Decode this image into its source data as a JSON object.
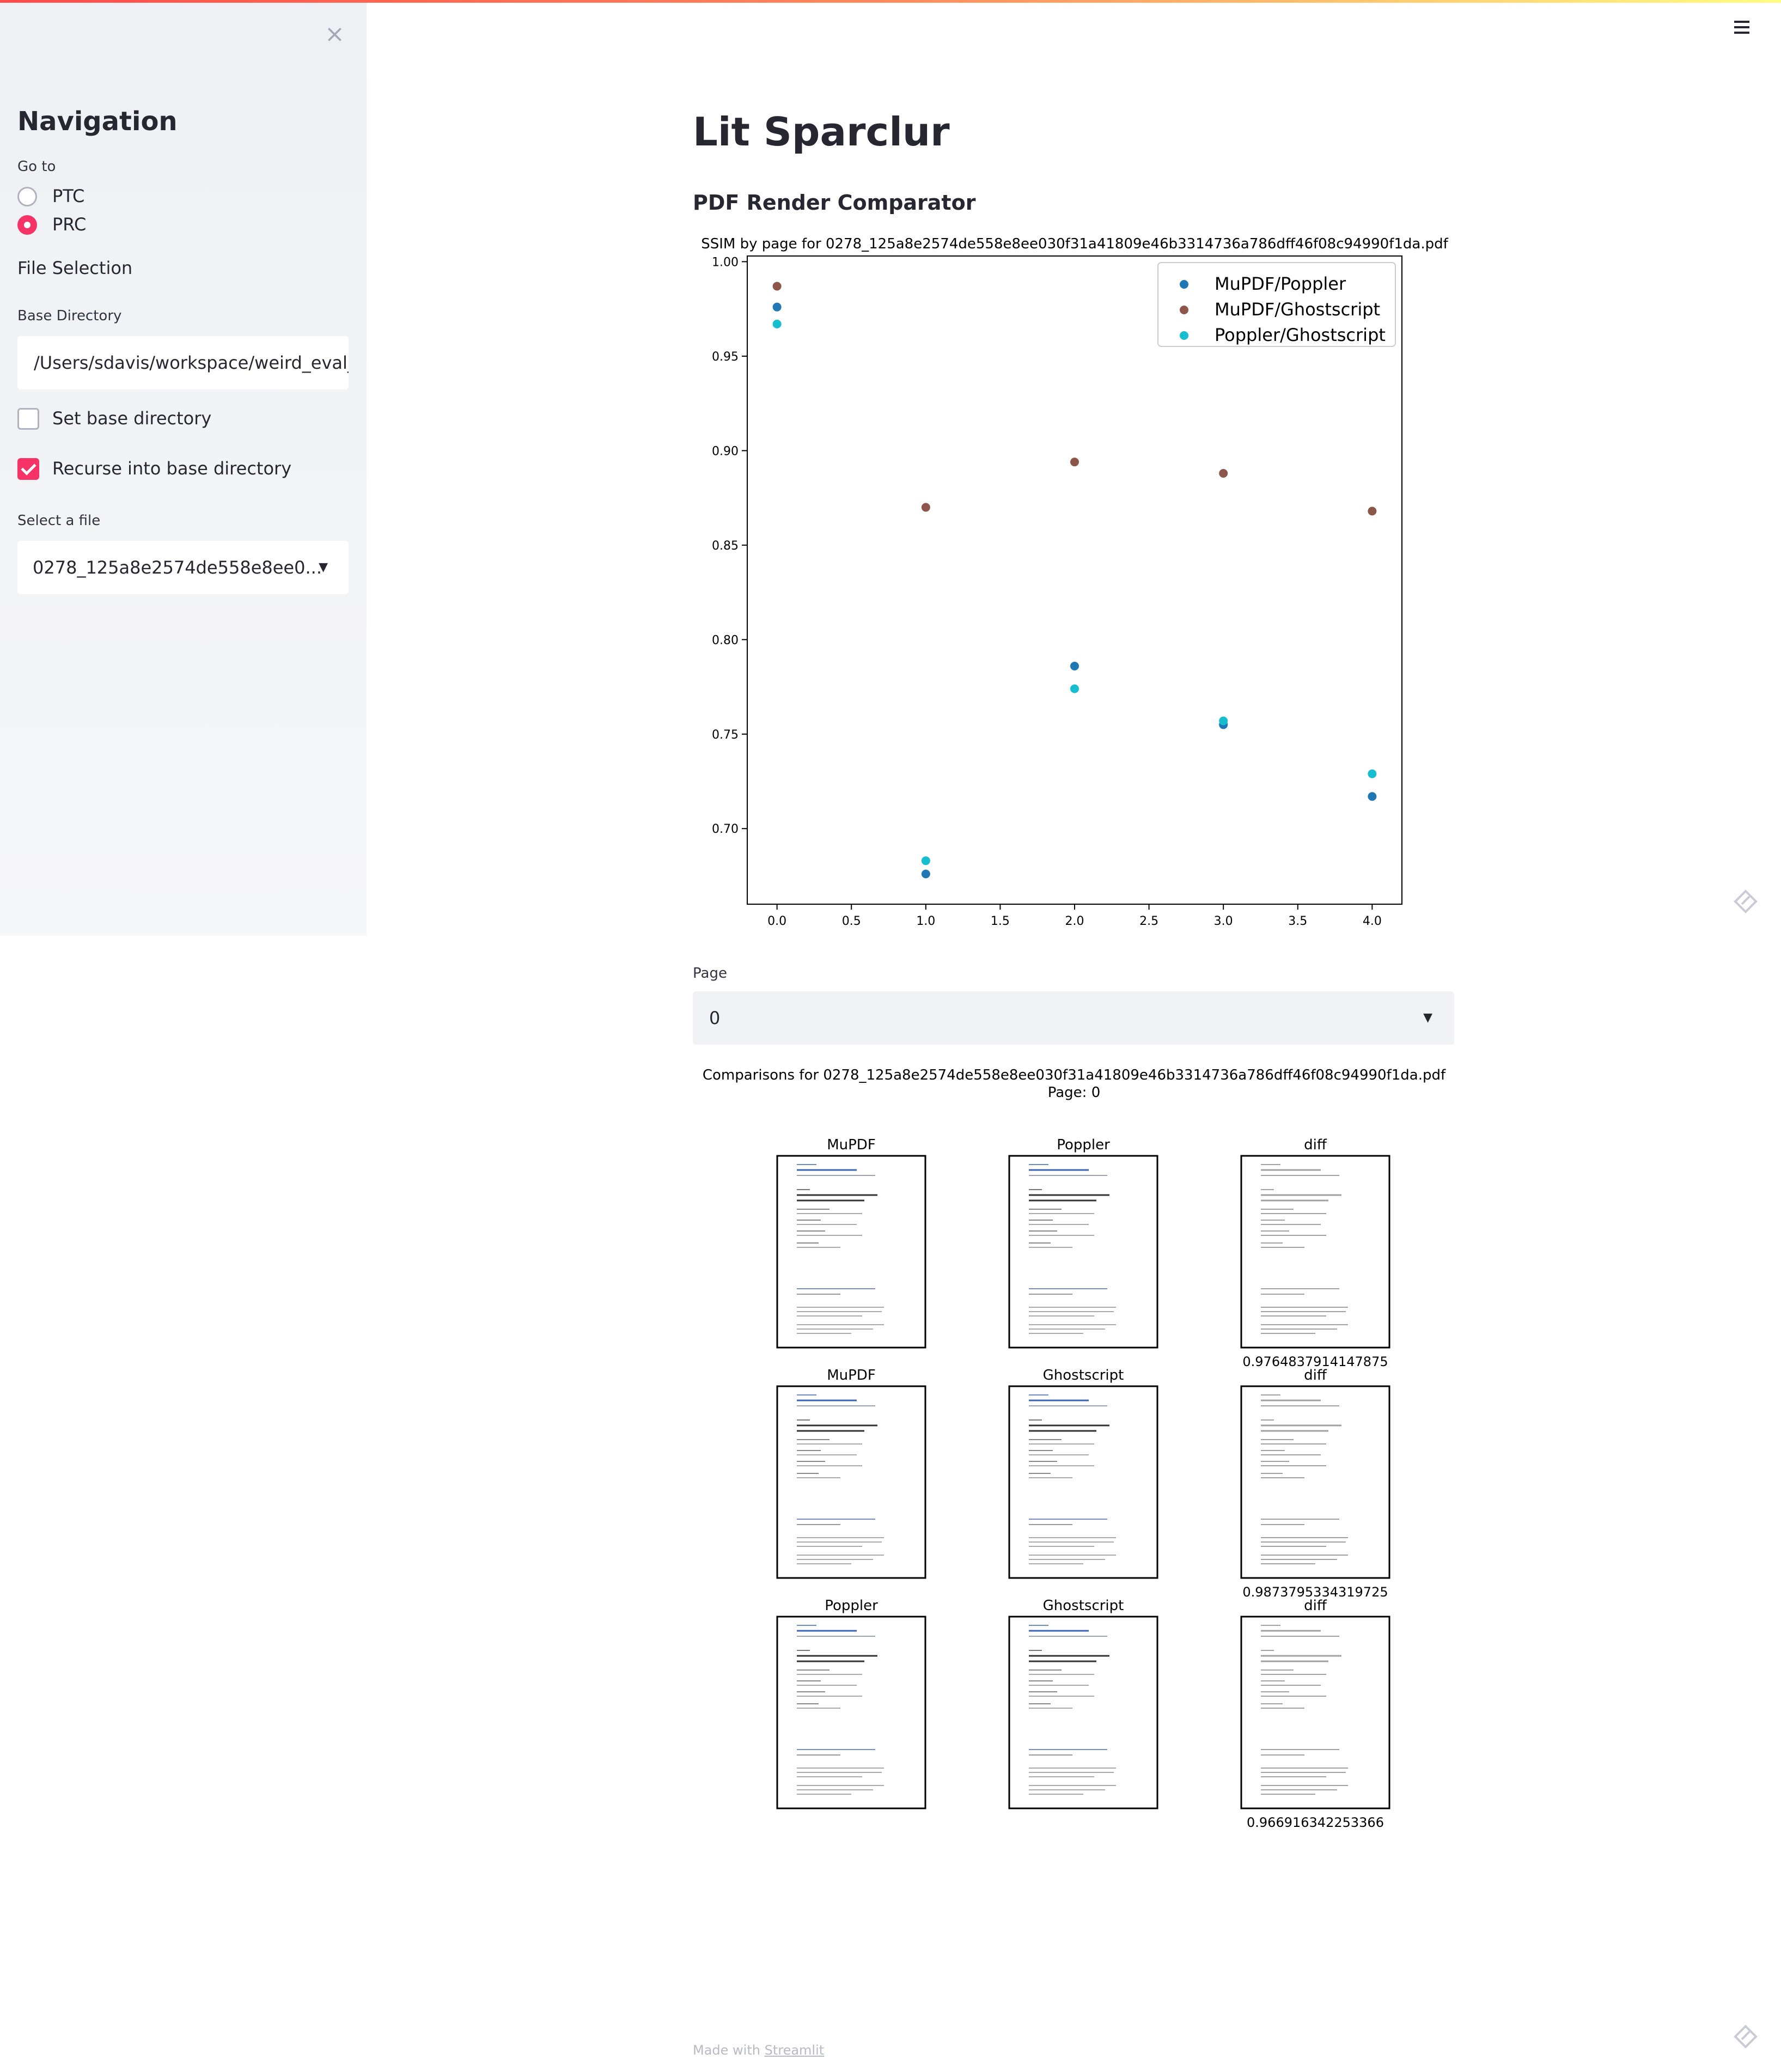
{
  "sidebar": {
    "close_glyph": "×",
    "title": "Navigation",
    "goto_label": "Go to",
    "nav_options": [
      {
        "label": "PTC",
        "selected": false
      },
      {
        "label": "PRC",
        "selected": true
      }
    ],
    "file_selection_label": "File Selection",
    "base_directory_label": "Base Directory",
    "base_directory_value": "/Users/sdavis/workspace/weird_eval_",
    "set_base_directory": {
      "label": "Set base directory",
      "checked": false
    },
    "recurse": {
      "label": "Recurse into base directory",
      "checked": true
    },
    "select_file_label": "Select a file",
    "select_file_value": "0278_125a8e2574de558e8ee0..."
  },
  "main": {
    "title": "Lit Sparclur",
    "subheader": "PDF Render Comparator",
    "page_select_label": "Page",
    "page_select_value": "0",
    "comparisons_title": "Comparisons for 0278_125a8e2574de558e8ee030f31a41809e46b3314736a786dff46f08c94990f1da.pdf",
    "comparisons_page": "Page: 0",
    "comparison_rows": [
      {
        "left": "MuPDF",
        "right": "Poppler",
        "diff": "diff",
        "score": "0.9764837914147875"
      },
      {
        "left": "MuPDF",
        "right": "Ghostscript",
        "diff": "diff",
        "score": "0.9873795334319725"
      },
      {
        "left": "Poppler",
        "right": "Ghostscript",
        "diff": "diff",
        "score": "0.966916342253366"
      }
    ]
  },
  "footer": {
    "prefix": "Made with ",
    "link": "Streamlit"
  },
  "icons": {
    "menu": "hamburger-icon",
    "close": "close-icon",
    "edit": "streamlit-diamond-icon"
  },
  "colors": {
    "accent": "#f63366",
    "series_1": "#1f77b4",
    "series_2": "#8c564b",
    "series_3": "#17becf"
  },
  "chart_data": {
    "type": "scatter",
    "title": "SSIM by page for 0278_125a8e2574de558e8ee030f31a41809e46b3314736a786dff46f08c94990f1da.pdf",
    "xlabel": "",
    "ylabel": "",
    "xlim": [
      -0.2,
      4.2
    ],
    "ylim": [
      0.66,
      1.003
    ],
    "xticks": [
      "0.0",
      "0.5",
      "1.0",
      "1.5",
      "2.0",
      "2.5",
      "3.0",
      "3.5",
      "4.0"
    ],
    "yticks": [
      "0.70",
      "0.75",
      "0.80",
      "0.85",
      "0.90",
      "0.95",
      "1.00"
    ],
    "legend_position": "top-right",
    "series": [
      {
        "name": "MuPDF/Poppler",
        "color": "#1f77b4",
        "x": [
          0,
          1,
          2,
          3,
          4
        ],
        "y": [
          0.976,
          0.676,
          0.786,
          0.755,
          0.717
        ]
      },
      {
        "name": "MuPDF/Ghostscript",
        "color": "#8c564b",
        "x": [
          0,
          1,
          2,
          3,
          4
        ],
        "y": [
          0.987,
          0.87,
          0.894,
          0.888,
          0.868
        ]
      },
      {
        "name": "Poppler/Ghostscript",
        "color": "#17becf",
        "x": [
          0,
          1,
          2,
          3,
          4
        ],
        "y": [
          0.967,
          0.683,
          0.774,
          0.757,
          0.729
        ]
      }
    ]
  }
}
